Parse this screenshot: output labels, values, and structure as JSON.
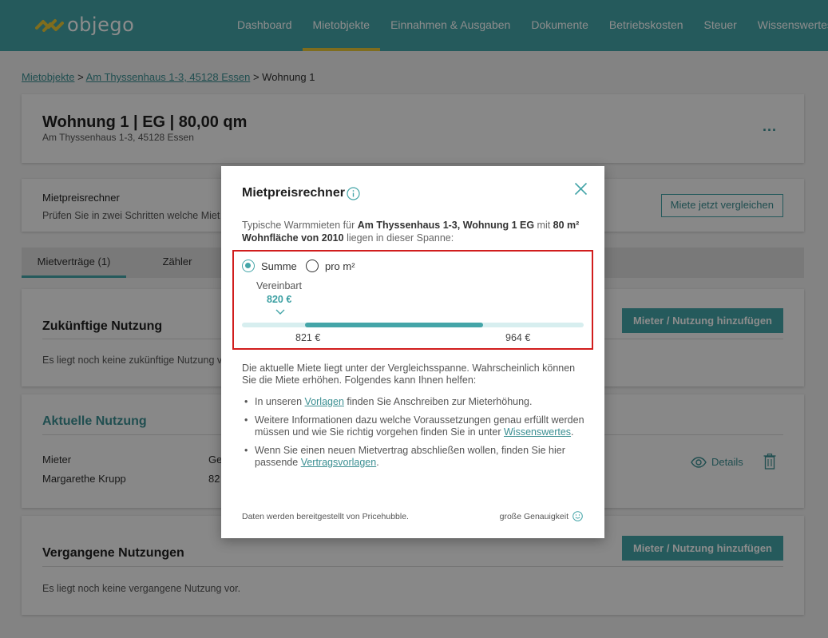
{
  "header": {
    "logo_text": "objego",
    "nav": [
      "Dashboard",
      "Mietobjekte",
      "Einnahmen & Ausgaben",
      "Dokumente",
      "Betriebskosten",
      "Steuer",
      "Wissenswertes"
    ],
    "active_nav_index": 1
  },
  "breadcrumb": {
    "item1": "Mietobjekte",
    "sep": ">",
    "item2": "Am Thyssenhaus 1-3, 45128 Essen",
    "current": "Wohnung 1"
  },
  "property": {
    "title": "Wohnung 1 | EG | 80,00 qm",
    "address": "Am Thyssenhaus 1-3, 45128 Essen",
    "menu": "..."
  },
  "mietpreis_card": {
    "label": "Mietpreisrechner",
    "desc": "Prüfen Sie in zwei Schritten welche Miet",
    "button": "Miete jetzt vergleichen"
  },
  "tabs": [
    "Mietverträge (1)",
    "Zähler"
  ],
  "future": {
    "title": "Zukünftige Nutzung",
    "button": "Mieter / Nutzung hinzufügen",
    "empty": "Es liegt noch keine zukünftige Nutzung v"
  },
  "current": {
    "title": "Aktuelle Nutzung",
    "col_mieter": "Mieter",
    "col_other": "Ge",
    "tenant": "Margarethe Krupp",
    "value_partial": "82",
    "details": "Details"
  },
  "past": {
    "title": "Vergangene Nutzungen",
    "button": "Mieter / Nutzung hinzufügen",
    "empty": "Es liegt noch keine vergangene Nutzung vor."
  },
  "modal": {
    "title": "Mietpreisrechner",
    "intro_pre": "Typische Warmmieten für ",
    "intro_bold1": "Am Thyssenhaus 1-3, Wohnung 1 EG",
    "intro_mid": " mit ",
    "intro_bold2": "80 m² Wohnfläche von 2010",
    "intro_post": " liegen in dieser Spanne:",
    "radio_sum": "Summe",
    "radio_sqm": "pro m²",
    "selected_mode": "Summe",
    "agreed_label": "Vereinbart",
    "agreed_value": "820 €",
    "range": {
      "min_label": "821 €",
      "max_label": "964 €",
      "min": 821,
      "max": 964,
      "scale_min": 770,
      "scale_max": 1045
    },
    "analysis": "Die aktuelle Miete liegt unter der Vergleichsspanne. Wahrscheinlich können Sie die Miete erhöhen. Folgendes kann Ihnen helfen:",
    "tip1_pre": "In unseren ",
    "tip1_link": "Vorlagen",
    "tip1_post": " finden Sie Anschreiben zur Mieterhöhung.",
    "tip2_pre": "Weitere Informationen dazu welche Voraussetzungen genau erfüllt werden müssen und wie Sie richtig vorgehen finden Sie in unter ",
    "tip2_link": "Wissenswertes",
    "tip2_post": ".",
    "tip3_pre": "Wenn Sie einen neuen Mietvertrag abschließen wollen, finden Sie hier passende ",
    "tip3_link": "Vertragsvorlagen",
    "tip3_post": ".",
    "source": "Daten werden bereitgestellt von Pricehubble.",
    "accuracy": "große Genauigkeit"
  },
  "colors": {
    "brand": "#44a5a8",
    "accent": "#e8c637",
    "highlight": "#d11d1d"
  }
}
